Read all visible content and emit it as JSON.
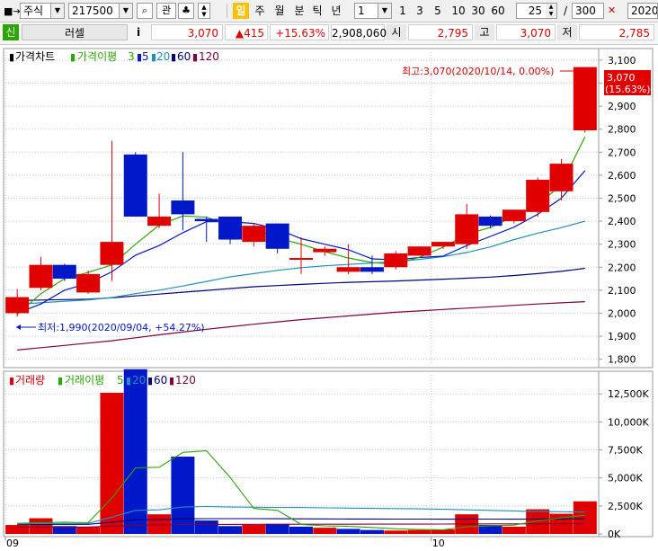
{
  "toolbar": {
    "market": "주식",
    "code": "217500",
    "gwan": "관",
    "active_period": "일",
    "periods": [
      "주",
      "월",
      "분",
      "틱",
      "년"
    ],
    "interval_value": "1",
    "quick_intervals": [
      "1",
      "3",
      "5",
      "10",
      "30",
      "60"
    ],
    "count_value": "25",
    "slash": "/",
    "total_value": "300",
    "date_value": "2020/"
  },
  "quote": {
    "badge": "신",
    "name": "러셀",
    "info": "i",
    "price": "3,070",
    "change": "▲415",
    "change_pct": "+15.63%",
    "volume": "2,908,060",
    "open_label": "시",
    "open": "2,795",
    "high_label": "고",
    "high": "3,070",
    "low_label": "저",
    "low": "2,785"
  },
  "colors": {
    "up": "#e00000",
    "down": "#0018c8",
    "ma3": "#2aa800",
    "ma5": "#0018c8",
    "ma20": "#1e90c0",
    "ma60": "#000080",
    "ma120": "#800040",
    "vol_ma5": "#2aa800"
  },
  "chart_data": [
    {
      "type": "candlestick",
      "title": "가격차트",
      "legend": [
        "가격이평",
        "3",
        "5",
        "20",
        "60",
        "120"
      ],
      "dates": [
        "2020-09-17",
        "2020-09-18",
        "2020-09-21",
        "2020-09-22",
        "2020-09-23",
        "2020-09-24",
        "2020-09-25",
        "2020-09-28",
        "2020-09-29",
        "2020-10-05",
        "2020-10-06",
        "2020-10-07",
        "2020-10-08",
        "2020-10-12",
        "2020-10-13",
        "2020-10-14",
        "2020-10-15",
        "2020-10-16",
        "2020-10-19",
        "2020-10-20",
        "2020-10-21",
        "2020-10-22",
        "2020-10-23",
        "2020-10-26",
        "2020-10-27"
      ],
      "ohlc": [
        [
          2000,
          2105,
          1985,
          2070
        ],
        [
          2110,
          2245,
          2100,
          2210
        ],
        [
          2210,
          2215,
          2140,
          2150
        ],
        [
          2090,
          2185,
          2085,
          2170
        ],
        [
          2210,
          2750,
          2140,
          2310
        ],
        [
          2690,
          2700,
          2420,
          2420
        ],
        [
          2380,
          2520,
          2370,
          2420
        ],
        [
          2490,
          2700,
          2360,
          2430
        ],
        [
          2410,
          2420,
          2310,
          2400
        ],
        [
          2420,
          2420,
          2300,
          2320
        ],
        [
          2310,
          2390,
          2290,
          2380
        ],
        [
          2390,
          2390,
          2260,
          2280
        ],
        [
          2240,
          2330,
          2170,
          2240
        ],
        [
          2265,
          2290,
          2250,
          2280
        ],
        [
          2180,
          2300,
          2170,
          2200
        ],
        [
          2200,
          2250,
          2170,
          2180
        ],
        [
          2200,
          2270,
          2190,
          2260
        ],
        [
          2250,
          2290,
          2250,
          2290
        ],
        [
          2290,
          2305,
          2280,
          2310
        ],
        [
          2300,
          2475,
          2280,
          2430
        ],
        [
          2420,
          2425,
          2370,
          2380
        ],
        [
          2400,
          2450,
          2390,
          2450
        ],
        [
          2440,
          2590,
          2420,
          2580
        ],
        [
          2530,
          2670,
          2490,
          2650
        ],
        [
          2795,
          3070,
          2785,
          3070
        ]
      ],
      "ma3": [
        1995,
        2085,
        2150,
        2177,
        2210,
        2300,
        2383,
        2423,
        2417,
        2383,
        2367,
        2327,
        2300,
        2267,
        2240,
        2220,
        2213,
        2243,
        2287,
        2343,
        2373,
        2420,
        2470,
        2560,
        2767
      ],
      "ma5": [
        2000,
        2040,
        2100,
        2130,
        2180,
        2252,
        2294,
        2350,
        2398,
        2398,
        2390,
        2366,
        2324,
        2300,
        2276,
        2236,
        2232,
        2242,
        2248,
        2294,
        2334,
        2374,
        2430,
        2500,
        2620
      ],
      "ma20": [
        2040,
        2045,
        2052,
        2058,
        2068,
        2085,
        2100,
        2118,
        2138,
        2158,
        2172,
        2186,
        2198,
        2206,
        2212,
        2218,
        2225,
        2234,
        2246,
        2264,
        2288,
        2320,
        2348,
        2372,
        2400
      ],
      "ma60": [
        2055,
        2057,
        2059,
        2061,
        2067,
        2075,
        2083,
        2091,
        2099,
        2107,
        2115,
        2120,
        2125,
        2130,
        2134,
        2137,
        2140,
        2144,
        2148,
        2152,
        2157,
        2164,
        2172,
        2182,
        2195
      ],
      "ma120": [
        1840,
        1850,
        1860,
        1870,
        1880,
        1893,
        1906,
        1918,
        1930,
        1941,
        1952,
        1962,
        1972,
        1980,
        1988,
        1996,
        2004,
        2010,
        2016,
        2022,
        2028,
        2034,
        2040,
        2045,
        2050
      ],
      "ylim": [
        1775,
        3135
      ],
      "y_ticks": [
        3100,
        3000,
        2900,
        2800,
        2700,
        2600,
        2500,
        2400,
        2300,
        2200,
        2100,
        2000,
        1900,
        1800
      ],
      "y_tick_labels": [
        "3,100",
        "3,000",
        "2,900",
        "2,800",
        "2,700",
        "2,600",
        "2,500",
        "2,400",
        "2,300",
        "2,200",
        "2,100",
        "2,000",
        "1,900",
        "1,800"
      ],
      "last_price_label": "3,070",
      "last_change_label": "(15.63%)",
      "high_annotation": "최고:3,070(2020/10/14, 0.00%)",
      "low_annotation": "최저:1,990(2020/09/04, +54.27%)"
    },
    {
      "type": "bar",
      "title": "거래량",
      "legend": [
        "거래이평",
        "5",
        "20",
        "60",
        "120"
      ],
      "volume": [
        800000,
        1400000,
        700000,
        600000,
        12600000,
        14700000,
        1750000,
        6900000,
        1200000,
        700000,
        800000,
        900000,
        650000,
        550000,
        450000,
        350000,
        300000,
        350000,
        400000,
        1750000,
        800000,
        650000,
        2200000,
        1800000,
        2908060
      ],
      "volume_up": [
        true,
        true,
        false,
        true,
        true,
        false,
        true,
        false,
        false,
        false,
        true,
        false,
        false,
        true,
        false,
        false,
        true,
        true,
        true,
        true,
        false,
        true,
        true,
        true,
        true
      ],
      "ma5": [
        950000,
        1000000,
        1050000,
        1000000,
        3200000,
        5900000,
        5950000,
        7280000,
        7420000,
        5050000,
        2270000,
        2100000,
        850000,
        720000,
        670000,
        580000,
        460000,
        400000,
        370000,
        630000,
        730000,
        790000,
        1160000,
        1440000,
        1670000
      ],
      "ma20": [
        900000,
        920000,
        930000,
        940000,
        1500000,
        2100000,
        2150000,
        2400000,
        2450000,
        2400000,
        2380000,
        2370000,
        2360000,
        2330000,
        2300000,
        2280000,
        2260000,
        2240000,
        2200000,
        2150000,
        2100000,
        2050000,
        2000000,
        1980000,
        1950000
      ],
      "ma60": [
        850000,
        860000,
        860000,
        860000,
        1050000,
        1250000,
        1270000,
        1350000,
        1360000,
        1360000,
        1360000,
        1355000,
        1350000,
        1340000,
        1335000,
        1330000,
        1325000,
        1320000,
        1315000,
        1320000,
        1320000,
        1315000,
        1325000,
        1335000,
        1350000
      ],
      "ma120": [
        600000,
        610000,
        615000,
        620000,
        700000,
        790000,
        800000,
        840000,
        845000,
        850000,
        855000,
        860000,
        865000,
        868000,
        870000,
        873000,
        875000,
        878000,
        880000,
        890000,
        895000,
        900000,
        910000,
        920000,
        930000
      ],
      "ylim": [
        0,
        14200000
      ],
      "y_ticks": [
        12500000,
        10000000,
        7500000,
        5000000,
        2500000,
        0
      ],
      "y_tick_labels": [
        "12,500K",
        "10,000K",
        "7,500K",
        "5,000K",
        "2,500K",
        "0K"
      ],
      "x_labels": [
        {
          "index": 0,
          "label": "09"
        },
        {
          "index": 18,
          "label": "10"
        }
      ]
    }
  ]
}
